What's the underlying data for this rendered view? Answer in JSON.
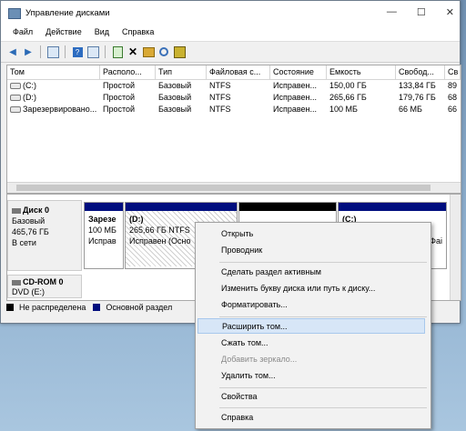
{
  "window": {
    "title": "Управление дисками",
    "buttons": [
      "—",
      "☐",
      "✕"
    ]
  },
  "menu": [
    "Файл",
    "Действие",
    "Вид",
    "Справка"
  ],
  "toolbar_icons": [
    "back-icon",
    "forward-icon",
    "grid-icon",
    "help-icon",
    "panel-icon",
    "check-icon",
    "delete-icon",
    "folder-icon",
    "search-icon",
    "properties-icon"
  ],
  "table": {
    "headers": [
      "Том",
      "Располо...",
      "Тип",
      "Файловая с...",
      "Состояние",
      "Емкость",
      "Свобод...",
      "Св"
    ],
    "rows": [
      [
        "(C:)",
        "Простой",
        "Базовый",
        "NTFS",
        "Исправен...",
        "150,00 ГБ",
        "133,84 ГБ",
        "89"
      ],
      [
        "(D:)",
        "Простой",
        "Базовый",
        "NTFS",
        "Исправен...",
        "265,66 ГБ",
        "179,76 ГБ",
        "68"
      ],
      [
        "Зарезервировано...",
        "Простой",
        "Базовый",
        "NTFS",
        "Исправен...",
        "100 МБ",
        "66 МБ",
        "66"
      ]
    ]
  },
  "disk0": {
    "name": "Диск 0",
    "type": "Базовый",
    "size": "465,76 ГБ",
    "status": "В сети"
  },
  "partitions": {
    "reserved": {
      "label": "Зарезе",
      "size": "100 МБ",
      "status": "Исправ"
    },
    "d": {
      "label": "(D:)",
      "size": "265,66 ГБ NTFS",
      "status": "Исправен (Осно"
    },
    "unalloc": {},
    "c": {
      "label": "(C:)",
      "extra": "Фаі"
    }
  },
  "cdrom": {
    "name": "CD-ROM 0",
    "type": "DVD (E:)"
  },
  "legend": {
    "unallocated": {
      "label": "Не распределена",
      "color": "#000000"
    },
    "primary": {
      "label": "Основной раздел",
      "color": "#000e7e"
    }
  },
  "context_menu": {
    "open": "Открыть",
    "explorer": "Проводник",
    "mark_active": "Сделать раздел активным",
    "change_letter": "Изменить букву диска или путь к диску...",
    "format": "Форматировать...",
    "extend": "Расширить том...",
    "shrink": "Сжать том...",
    "add_mirror": "Добавить зеркало...",
    "delete": "Удалить том...",
    "properties": "Свойства",
    "help": "Справка"
  }
}
